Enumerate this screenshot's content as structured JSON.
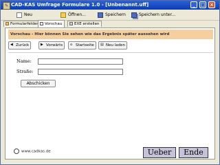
{
  "window": {
    "title": "CAD-KAS Umfrage Formulare 1.0 - [Unbenannt.uff]",
    "min_label": "_",
    "max_label": "□",
    "close_label": "×"
  },
  "toolbar": {
    "new_label": "Neu",
    "open_label": "Öffnen...",
    "save_label": "Speichern",
    "save_as_label": "Speichern unter..."
  },
  "tabs": [
    {
      "label": "Formularfelder"
    },
    {
      "label": "Vorschau"
    },
    {
      "label": "EXE erstellen"
    }
  ],
  "preview": {
    "banner_text": "Vorschau - Hier können Sie sehen wie das Ergebnis später aussehen wird",
    "nav": {
      "back_label": "Zurück",
      "forward_label": "Vorwärts",
      "home_label": "Startseite",
      "reload_label": "Neu laden"
    },
    "form": {
      "name_label": "Name:",
      "name_value": "",
      "street_label": "Straße:",
      "street_value": "",
      "submit_label": "Abschicken"
    }
  },
  "footer": {
    "website": "www.cadkas.de",
    "about_label": "Ueber",
    "exit_label": "Ende"
  }
}
